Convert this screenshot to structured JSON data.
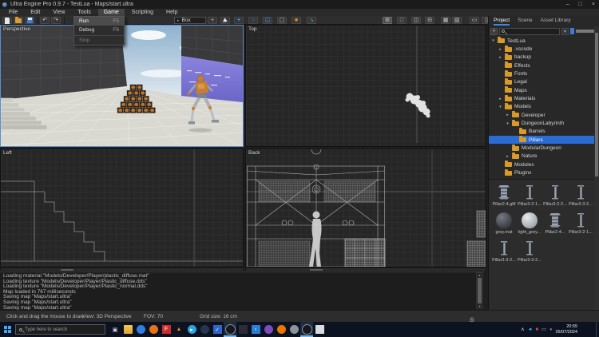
{
  "window": {
    "title": "Ultra Engine Pro 0.9.7 - TestLua - Maps/start.ultra",
    "controls": {
      "minimize": "–",
      "maximize": "□",
      "close": "×"
    }
  },
  "menubar": {
    "items": [
      {
        "label": "File"
      },
      {
        "label": "Edit"
      },
      {
        "label": "View"
      },
      {
        "label": "Tools"
      },
      {
        "label": "Game",
        "open": true
      },
      {
        "label": "Scripting"
      },
      {
        "label": "Help"
      }
    ]
  },
  "game_menu": {
    "items": [
      {
        "label": "Run",
        "shortcut": "F5",
        "highlighted": true
      },
      {
        "label": "Debug",
        "shortcut": "F8"
      },
      {
        "label": "Stop",
        "disabled": true
      }
    ]
  },
  "toolbar": {
    "object_type": "Box",
    "add_label": "+",
    "undo_glyph": "↶",
    "redo_glyph": "↷",
    "move_glyph": "+",
    "rotate_glyph": "○",
    "scale_glyph": "◱",
    "face_glyph": "▢",
    "cube_glyph": "■",
    "drop_glyph": "↘",
    "layout_glyphs": {
      "quad": "⊞",
      "single": "□",
      "columns": "◫",
      "rows": "⊟",
      "toggle_a": "▦",
      "toggle_b": "▧",
      "monitor_a": "▭",
      "monitor_b": "▯"
    }
  },
  "panel": {
    "tabs": [
      {
        "label": "Project",
        "active": true
      },
      {
        "label": "Scene"
      },
      {
        "label": "Asset Library"
      }
    ],
    "dropdown_glyph": "▼"
  },
  "viewports": {
    "perspective": "Perspective",
    "top": "Top",
    "left": "Left",
    "back": "Back"
  },
  "tree": [
    {
      "label": "TestLua",
      "level": 0,
      "arrow": "▾"
    },
    {
      "label": ".vscode",
      "level": 1,
      "arrow": "▸"
    },
    {
      "label": "backup",
      "level": 1,
      "arrow": "▸"
    },
    {
      "label": "Effects",
      "level": 1,
      "arrow": ""
    },
    {
      "label": "Fonts",
      "level": 1,
      "arrow": ""
    },
    {
      "label": "Legal",
      "level": 1,
      "arrow": ""
    },
    {
      "label": "Maps",
      "level": 1,
      "arrow": ""
    },
    {
      "label": "Materials",
      "level": 1,
      "arrow": "▸"
    },
    {
      "label": "Models",
      "level": 1,
      "arrow": "▾"
    },
    {
      "label": "Developer",
      "level": 2,
      "arrow": "▸"
    },
    {
      "label": "DungeonLabyrinth",
      "level": 2,
      "arrow": "▾"
    },
    {
      "label": "Barrels",
      "level": 3,
      "arrow": ""
    },
    {
      "label": "Pillars",
      "level": 3,
      "arrow": "",
      "selected": true
    },
    {
      "label": "ModularDungeon",
      "level": 2,
      "arrow": ""
    },
    {
      "label": "Nature",
      "level": 2,
      "arrow": "▸"
    },
    {
      "label": "Modules",
      "level": 1,
      "arrow": ""
    },
    {
      "label": "Plugins",
      "level": 1,
      "arrow": ""
    }
  ],
  "assets": [
    {
      "label": "Pillar2-4.gltf",
      "type": "pillar-wide"
    },
    {
      "label": "Pillar3-2-1...",
      "type": "pillar"
    },
    {
      "label": "Pillar3-2-2...",
      "type": "pillar"
    },
    {
      "label": "Pillar3-3-2...",
      "type": "pillar"
    },
    {
      "label": "grey.mat",
      "type": "sphere-dark"
    },
    {
      "label": "light_grey...",
      "type": "sphere-light"
    },
    {
      "label": "Pillar2-4...",
      "type": "pillar-wide"
    },
    {
      "label": "Pillar3-2-1...",
      "type": "pillar"
    },
    {
      "label": "Pillar3-3-2...",
      "type": "pillar"
    },
    {
      "label": "Pillar3-3-2...",
      "type": "pillar"
    }
  ],
  "console": {
    "lines": [
      "Loading material \"Models/Developer/Player/plastic_diffuse.mat\"",
      "Loading texture \"Models/Developer/Player/Plastic_diffuse.dds\"",
      "Loading texture \"Models/Developer/Player/Plastic_normal.dds\"",
      "Map loaded in 767 milliseconds",
      "Saving map \"Maps/start.ultra\"",
      "Saving map \"Maps/start.ultra\"",
      "Saving map \"Maps/start.ultra\""
    ]
  },
  "statusbar": {
    "hint": "Click and drag the mouse to draw",
    "view": "View: 3D Perspective",
    "fov": "FOV: 70",
    "grid_size": "Grid size: 16 cm",
    "icons": [
      "△",
      "◎"
    ]
  },
  "taskbar": {
    "search_placeholder": "Type here to search",
    "apps": [
      {
        "name": "task-view",
        "glyph": "▣",
        "fg": "#c9d3e0",
        "shape": "plain"
      },
      {
        "name": "file-explorer",
        "glyph": "",
        "shape": "folder"
      },
      {
        "name": "app-blue",
        "glyph": "",
        "bg": "#2f7fe0",
        "shape": "circle"
      },
      {
        "name": "firefox",
        "glyph": "",
        "bg": "#e8711a",
        "shape": "circle"
      },
      {
        "name": "flameshot",
        "glyph": "F",
        "bg": "#cf2b2b",
        "shape": "square"
      },
      {
        "name": "vlc",
        "glyph": "▲",
        "fg": "#ef8a1d",
        "shape": "plain"
      },
      {
        "name": "telegram",
        "glyph": "▸",
        "bg": "#2ba3df",
        "shape": "circle"
      },
      {
        "name": "app-navy",
        "glyph": "",
        "bg": "#27344e",
        "shape": "circle"
      },
      {
        "name": "todo",
        "glyph": "✓",
        "bg": "#2e66c9",
        "shape": "square"
      },
      {
        "name": "ultra-engine",
        "glyph": "",
        "bg": "#17171c",
        "shape": "circle",
        "active": true
      },
      {
        "name": "app-dark",
        "glyph": "",
        "bg": "#2c2c34",
        "shape": "square"
      },
      {
        "name": "vscode",
        "glyph": "‹",
        "bg": "#2a7fd4",
        "shape": "square"
      },
      {
        "name": "visual-studio",
        "glyph": "",
        "bg": "#7d4bc0",
        "shape": "circle"
      },
      {
        "name": "blender",
        "glyph": "",
        "bg": "#ea7600",
        "shape": "circle"
      },
      {
        "name": "gimp",
        "glyph": "",
        "bg": "#8d939c",
        "shape": "circle"
      },
      {
        "name": "ultra-engine-2",
        "glyph": "",
        "bg": "#17171c",
        "shape": "circle",
        "active": true
      },
      {
        "name": "notepad",
        "glyph": "",
        "bg": "#d8dce2",
        "shape": "square"
      }
    ],
    "tray": [
      {
        "name": "tray-caret",
        "glyph": "∧",
        "fg": "#dfe3e8"
      },
      {
        "name": "tray-app",
        "glyph": "◄",
        "fg": "#4ba3e3"
      },
      {
        "name": "tray-red",
        "glyph": "■",
        "fg": "#d04545"
      },
      {
        "name": "tray-display",
        "glyph": "▭",
        "fg": "#cfd4da"
      },
      {
        "name": "tray-volume",
        "glyph": "◖",
        "fg": "#cfd4da"
      }
    ],
    "clock_time": "20:55",
    "clock_date": "26/07/2024"
  },
  "colors": {
    "accent": "#3f87e6",
    "selection": "#2a6bd4",
    "folder": "#d89a2b"
  }
}
